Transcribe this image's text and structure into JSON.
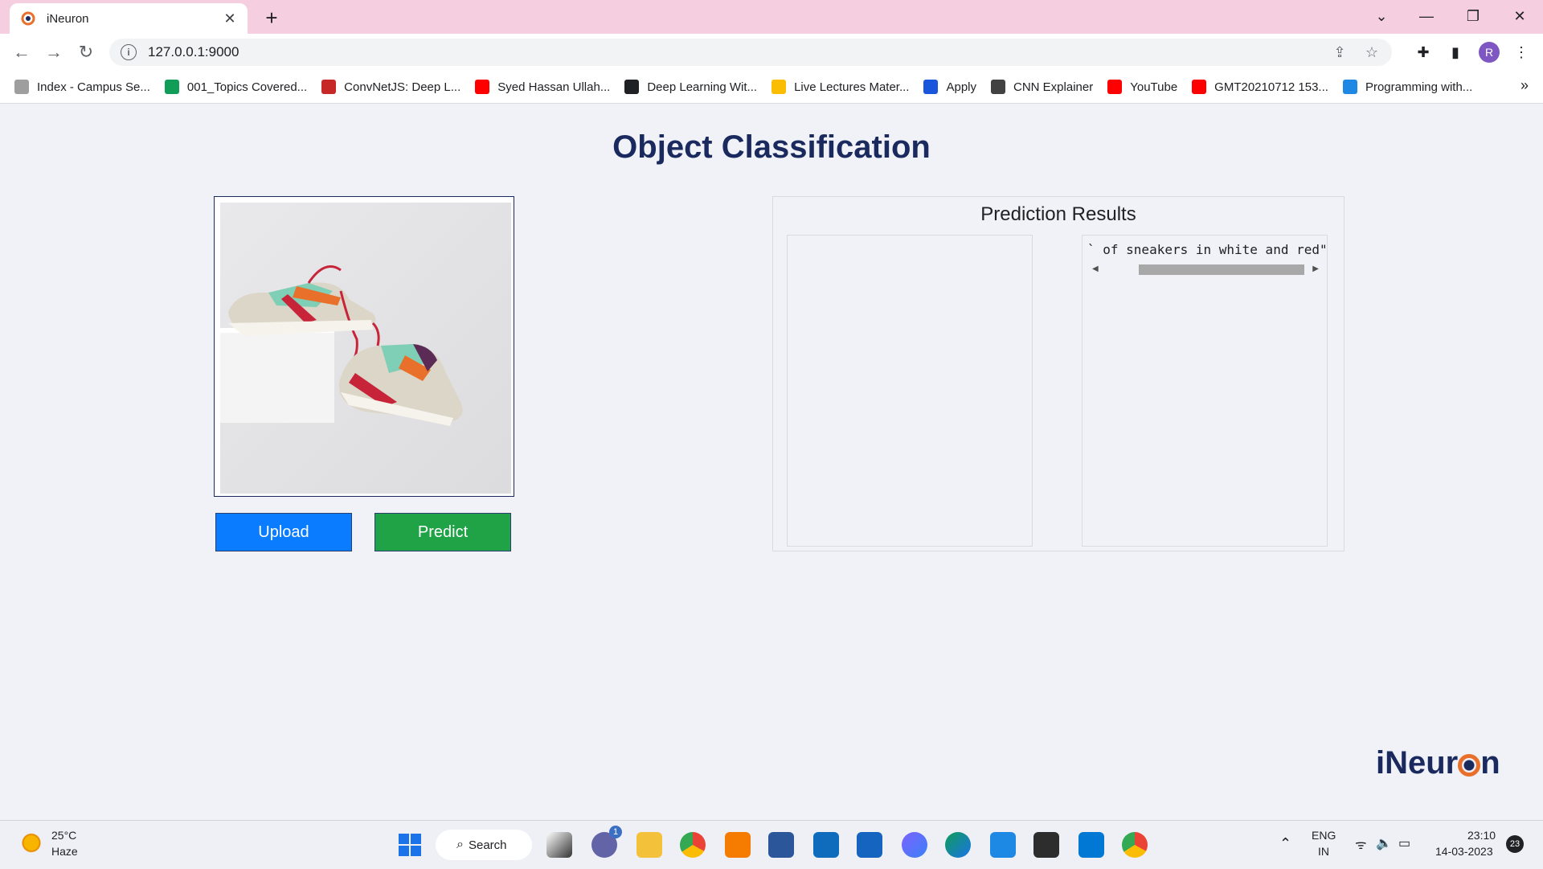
{
  "browser": {
    "tab_title": "iNeuron",
    "tab_close": "✕",
    "new_tab": "+",
    "url": "127.0.0.1:9000",
    "bookmarks": [
      {
        "label": "Index - Campus Se...",
        "icon": "campus-icon",
        "color": "#9e9e9e"
      },
      {
        "label": "001_Topics Covered...",
        "icon": "sheets-icon",
        "color": "#0f9d58"
      },
      {
        "label": "ConvNetJS: Deep L...",
        "icon": "convnet-icon",
        "color": "#c62828"
      },
      {
        "label": "Syed Hassan Ullah...",
        "icon": "youtube-icon",
        "color": "#ff0000"
      },
      {
        "label": "Deep Learning Wit...",
        "icon": "globe-icon",
        "color": "#202124"
      },
      {
        "label": "Live Lectures Mater...",
        "icon": "drive-icon",
        "color": "#fbbc04"
      },
      {
        "label": "Apply",
        "icon": "apply-icon",
        "color": "#1a56db"
      },
      {
        "label": "CNN Explainer",
        "icon": "cnn-explainer-icon",
        "color": "#424242"
      },
      {
        "label": "YouTube",
        "icon": "youtube-icon",
        "color": "#ff0000"
      },
      {
        "label": "GMT20210712 153...",
        "icon": "youtube-icon",
        "color": "#ff0000"
      },
      {
        "label": "Programming with...",
        "icon": "is-icon",
        "color": "#1e88e5"
      }
    ],
    "bookmarks_more": "»",
    "profile_initial": "R"
  },
  "page": {
    "title": "Object Classification",
    "upload_label": "Upload",
    "predict_label": "Predict",
    "results_title": "Prediction Results",
    "result_text": "` of sneakers in white and red\"",
    "logo_pre": "iNeur",
    "logo_post": "n"
  },
  "taskbar": {
    "temp": "25°C",
    "weather": "Haze",
    "search_label": "Search",
    "chat_badge": "1",
    "lang": "ENG",
    "region": "IN",
    "time": "23:10",
    "date": "14-03-2023",
    "notif_count": "23"
  },
  "colors": {
    "title": "#1b2a5e",
    "upload": "#0a7cff",
    "predict": "#1fa346",
    "tabstrip": "#f5cfe0",
    "logo_accent": "#e8702a"
  }
}
